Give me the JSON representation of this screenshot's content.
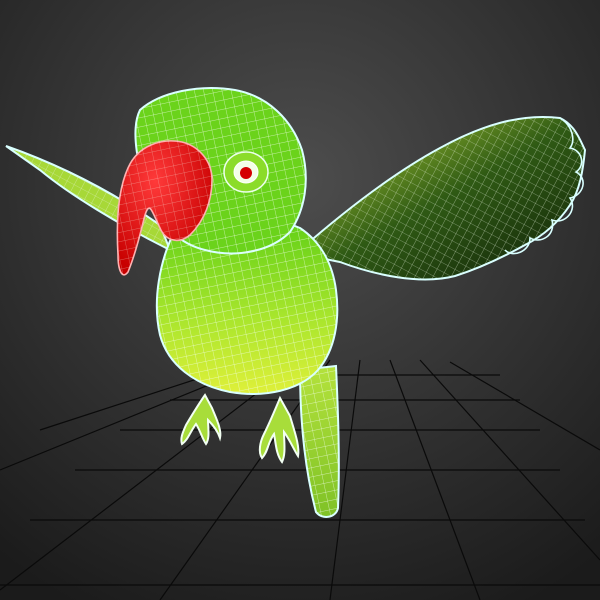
{
  "scene": {
    "subject": "parrot-3d-wireframe-model",
    "colors": {
      "background_top": "#4a4a4a",
      "background_bottom": "#1c1c1c",
      "grid": "#0b0b0b",
      "body_green": "#7ed321",
      "body_light": "#d8ee3a",
      "beak_red": "#ff1a1a",
      "wireframe": "#f4fff0",
      "outline_glow": "#d9ffff",
      "eye_red": "#d40000",
      "claw": "#f2fff2"
    }
  }
}
